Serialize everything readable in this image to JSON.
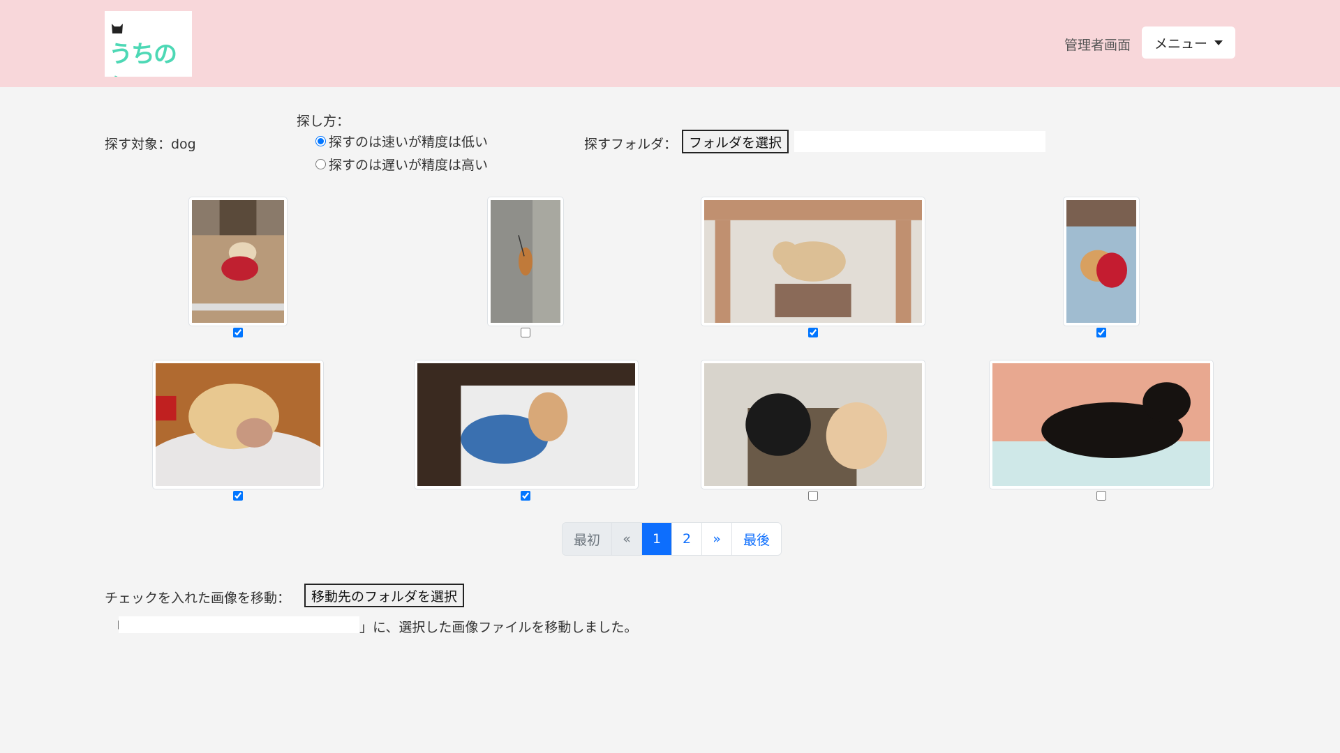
{
  "header": {
    "logo_text": "うちの仔",
    "admin_link": "管理者画面",
    "menu_label": "メニュー"
  },
  "search": {
    "target_label": "探す対象：dog",
    "method_label": "探し方：",
    "method_options": [
      "探すのは速いが精度は低い",
      "探すのは遅いが精度は高い"
    ],
    "method_selected": 0,
    "folder_label": "探すフォルダ：",
    "folder_button": "フォルダを選択",
    "folder_value": ""
  },
  "gallery": {
    "items": [
      {
        "subject": "dachshund in red sweater sitting on wooden floor",
        "checked": true
      },
      {
        "subject": "dog on leash walking on pavement",
        "checked": false
      },
      {
        "subject": "dog with toy under table",
        "checked": true
      },
      {
        "subject": "dog in red clothes lying on blue blanket",
        "checked": true
      },
      {
        "subject": "dog sleeping with head on cushion",
        "checked": true
      },
      {
        "subject": "dog in blue shirt lying on white chair",
        "checked": true
      },
      {
        "subject": "black cat and dog sleeping together",
        "checked": false
      },
      {
        "subject": "black cat yawning on towel",
        "checked": false
      }
    ]
  },
  "pagination": {
    "first": "最初",
    "prev": "«",
    "pages": [
      "1",
      "2"
    ],
    "active": "1",
    "next": "»",
    "last": "最後"
  },
  "move": {
    "label": "チェックを入れた画像を移動：",
    "button": "移動先のフォルダを選択",
    "result_open": "「",
    "result_folder": "",
    "result_close": "」に、選択した画像ファイルを移動しました。"
  },
  "colors": {
    "header_bg": "#f8d7da",
    "page_bg": "#f4f4f4",
    "accent": "#0d6efd",
    "logo_text": "#4dd8b5"
  }
}
